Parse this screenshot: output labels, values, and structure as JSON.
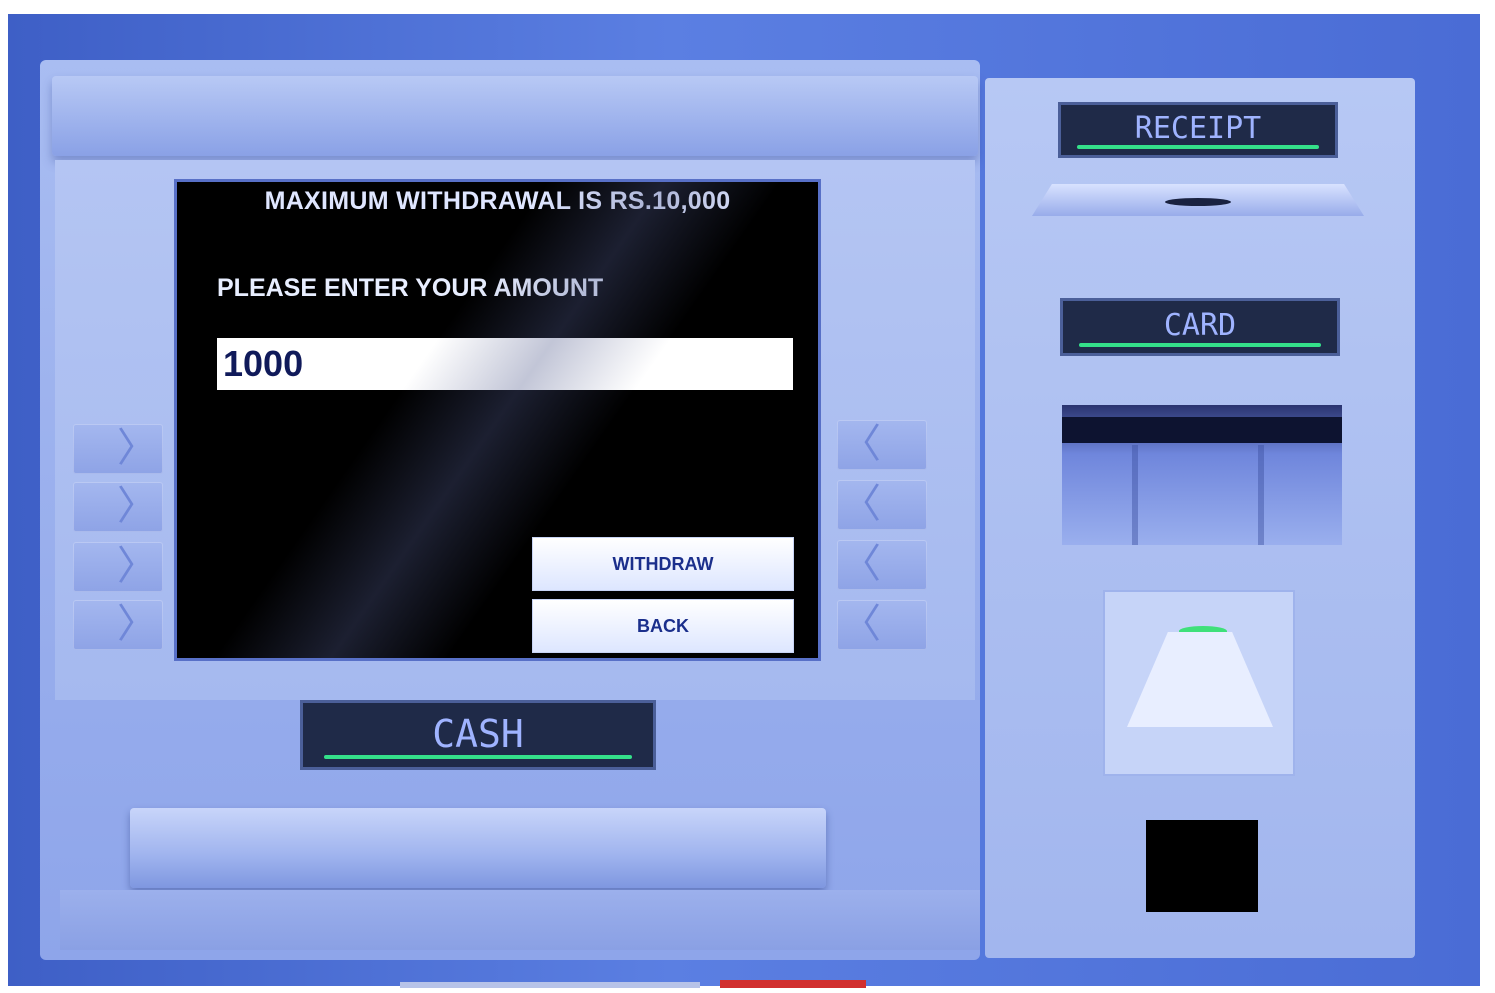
{
  "screen": {
    "max_withdrawal_text": "MAXIMUM WITHDRAWAL IS RS.10,000",
    "prompt_text": "PLEASE ENTER YOUR AMOUNT",
    "amount_value": "1000",
    "withdraw_label": "WITHDRAW",
    "back_label": "BACK"
  },
  "side_buttons": {
    "left_glyph": "〉",
    "right_glyph": "〈"
  },
  "labels": {
    "cash": "CASH",
    "receipt": "RECEIPT",
    "card": "CARD"
  },
  "icons": {
    "pin_pad": "pin-pad-icon",
    "status_led": "green-led-icon"
  },
  "colors": {
    "accent_green": "#34e08a",
    "label_text": "#9fb3ff",
    "screen_bg": "#000000"
  }
}
